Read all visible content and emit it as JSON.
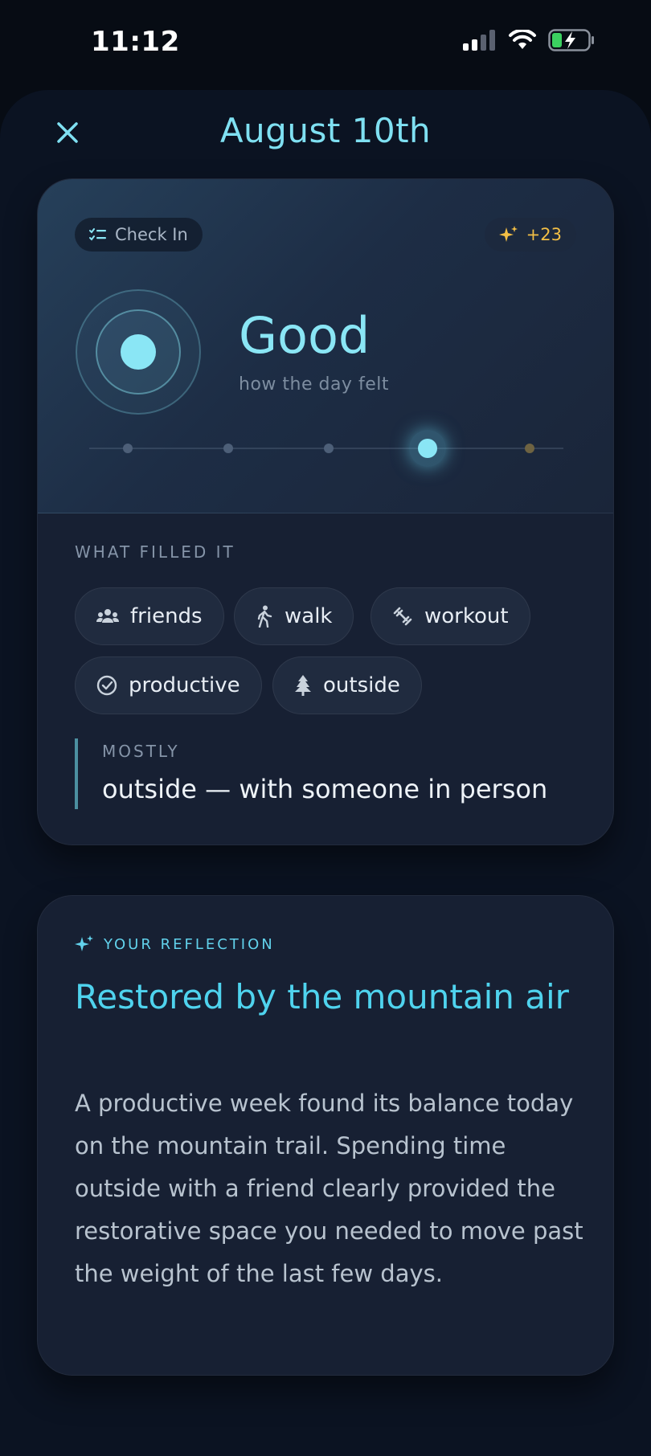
{
  "status_bar": {
    "time": "11:12",
    "icons": [
      "cellular-signal-icon",
      "wifi-icon",
      "battery-charging-icon"
    ]
  },
  "header": {
    "title": "August 10th",
    "close_icon": "close-icon"
  },
  "checkin_card": {
    "chip_label": "Check In",
    "points": "+23",
    "mood": {
      "title": "Good",
      "subtitle": "how the day felt",
      "scale_steps": 5,
      "selected_index": 3
    },
    "section_label": "WHAT FILLED IT",
    "tags": [
      {
        "label": "friends",
        "icon": "people-icon"
      },
      {
        "label": "walk",
        "icon": "walking-person-icon"
      },
      {
        "label": "workout",
        "icon": "dumbbell-icon"
      },
      {
        "label": "productive",
        "icon": "check-circle-icon"
      },
      {
        "label": "outside",
        "icon": "tree-icon"
      }
    ],
    "mostly_label": "MOSTLY",
    "mostly_text": "outside — with someone in person"
  },
  "reflection_card": {
    "label": "YOUR REFLECTION",
    "title": "Restored by the mountain air",
    "body": "A productive week found its balance today on the mountain trail. Spending time outside with a friend clearly provided the restorative space you needed to move past the weight of the last few days."
  },
  "colors": {
    "accent_cyan": "#8ae6f5",
    "title_cyan": "#4fd3ee",
    "points_gold": "#f3bf45",
    "background": "#070c14",
    "card": "#172033"
  }
}
